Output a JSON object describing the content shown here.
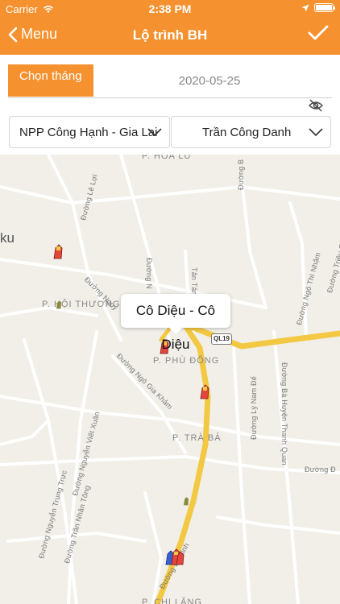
{
  "status_bar": {
    "carrier": "Carrier",
    "time": "2:38 PM"
  },
  "nav": {
    "back_label": "Menu",
    "title": "Lộ trình BH"
  },
  "month": {
    "button_label": "Chọn tháng",
    "date_value": "2020-05-25"
  },
  "filters": {
    "distributor": "NPP Công Hạnh - Gia Lai",
    "salesperson": "Trần Công Danh"
  },
  "map": {
    "labels": {
      "hoa_lu": "P. HOA LƯ",
      "ku": "ku",
      "hoi_thuong": "P. HỘI THƯƠNG",
      "phu_dong": "P. PHÙ ĐỔNG",
      "tra_ba": "P. TRÀ BÁ",
      "chi_lang": "P. CHI LĂNG",
      "road_qln": "QL19",
      "le_loi": "Đường Lê Lợi",
      "duong_n": "Đường N",
      "duong_nguyen": "Đường Nguy",
      "tan_tam": "Tân Tâm",
      "duong_b": "Đường B",
      "ngo_thi_nham": "Đường Ngô Thì Nhậm",
      "trieu_quang": "Đường Triệu Quang P",
      "ngo_gia_kham": "Đường Ngô Gia Khảm",
      "ly_nam_de": "Đường Lý Nam Đế",
      "ba_huyen": "Đường Bà Huyện Thanh Quan",
      "nguyen_viet_xuan": "Đường Nguyễn Viết Xuân",
      "nguyen_trung_truc": "Đường Nguyễn Trung Trực",
      "tran_nhan_tong": "Đường Trần Nhân Tông",
      "duong_d": "Đường Đ",
      "duong_le_chinh": "Đường L Chinh"
    },
    "tooltip": "Cô Diệu - Cô Diệu",
    "colors": {
      "accent": "#f5922f",
      "highway": "#f3c842",
      "map_bg": "#f1efe8"
    }
  }
}
